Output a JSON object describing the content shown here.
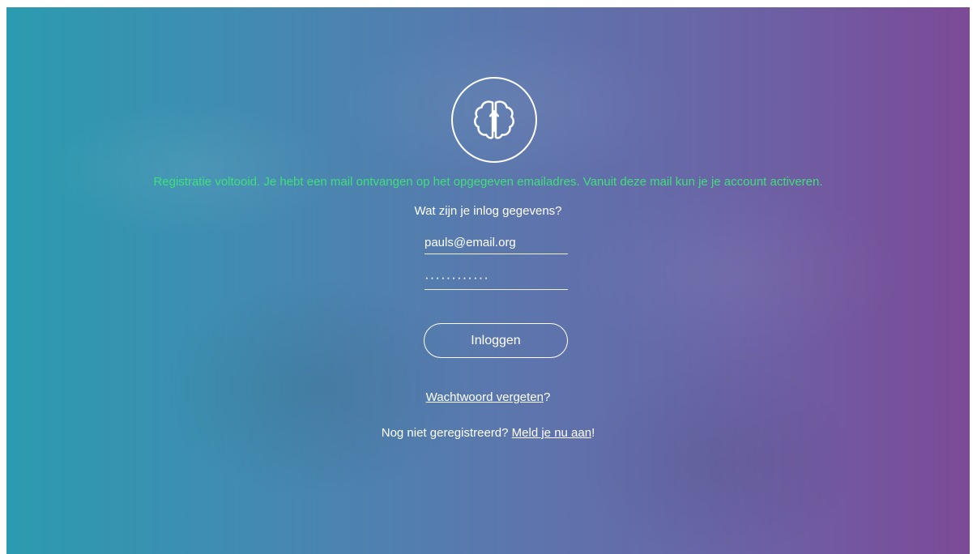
{
  "logo": {
    "icon": "brain-icon"
  },
  "messages": {
    "success": "Registratie voltooid. Je hebt een mail ontvangen op het opgegeven emailadres. Vanuit deze mail kun je je account activeren.",
    "success_color": "#3ee07a"
  },
  "login": {
    "question": "Wat zijn je inlog gegevens?",
    "email_value": "pauls@email.org",
    "password_value": "············",
    "button_label": "Inloggen"
  },
  "forgot": {
    "link_label": "Wachtwoord vergeten",
    "suffix": "?"
  },
  "register": {
    "prefix": "Nog niet geregistreerd? ",
    "link_label": "Meld je nu aan",
    "suffix": "!"
  },
  "colors": {
    "gradient_start": "#2b9bb0",
    "gradient_end": "#7c4a97"
  }
}
